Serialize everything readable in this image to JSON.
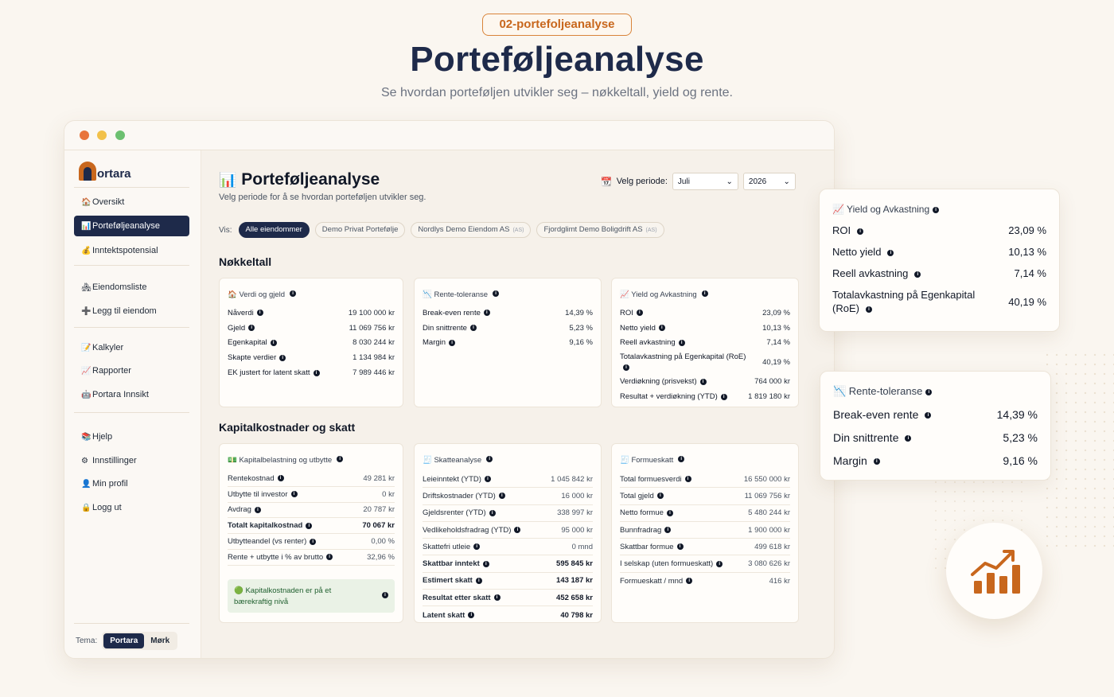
{
  "hero": {
    "tag": "02-portefoljeanalyse",
    "title": "Porteføljeanalyse",
    "subtitle": "Se hvordan porteføljen utvikler seg – nøkkeltall, yield og rente."
  },
  "colors": {
    "navy": "#1e2a4a",
    "accent": "#c8671d",
    "background": "#faf6f0"
  },
  "sidebar": {
    "logo_text": "ortara",
    "items": [
      {
        "icon": "house-icon",
        "glyph": "🏠",
        "label": "Oversikt"
      },
      {
        "icon": "bar-chart-icon",
        "glyph": "📊",
        "label": "Porteføljeanalyse",
        "active": true
      },
      {
        "icon": "money-bag-icon",
        "glyph": "💰",
        "label": "Inntektspotensial"
      },
      {
        "icon": "houses-icon",
        "glyph": "🏘",
        "label": "Eiendomsliste"
      },
      {
        "icon": "plus-icon",
        "glyph": "➕",
        "label": "Legg til eiendom"
      },
      {
        "icon": "memo-icon",
        "glyph": "📝",
        "label": "Kalkyler"
      },
      {
        "icon": "trend-up-icon",
        "glyph": "📈",
        "label": "Rapporter"
      },
      {
        "icon": "robot-icon",
        "glyph": "🤖",
        "label": "Portara Innsikt"
      },
      {
        "icon": "books-icon",
        "glyph": "📚",
        "label": "Hjelp"
      },
      {
        "icon": "gear-icon",
        "glyph": "⚙",
        "label": "Innstillinger"
      },
      {
        "icon": "user-icon",
        "glyph": "👤",
        "label": "Min profil"
      },
      {
        "icon": "lock-icon",
        "glyph": "🔒",
        "label": "Logg ut"
      }
    ],
    "theme": {
      "label": "Tema:",
      "option_1": "Portara",
      "option_2": "Mørk"
    }
  },
  "main": {
    "title": "Porteføljeanalyse",
    "title_icon": "bar-chart-icon",
    "subtitle": "Velg periode for å se hvordan porteføljen utvikler seg.",
    "period": {
      "label": "Velg periode:",
      "month": "Juli",
      "year": "2026"
    },
    "filter": {
      "label": "Vis:",
      "chips": [
        {
          "label": "Alle eiendommer",
          "tag": "",
          "active": true
        },
        {
          "label": "Demo Privat Portefølje",
          "tag": ""
        },
        {
          "label": "Nordlys Demo Eiendom AS",
          "tag": "(AS)"
        },
        {
          "label": "Fjordglimt Demo Boligdrift AS",
          "tag": "(AS)"
        }
      ]
    },
    "section_1": "Nøkkeltall",
    "section_2": "Kapitalkostnader og skatt",
    "card_verdi": {
      "title": "🏠 Verdi og gjeld",
      "rows": [
        {
          "label": "Nåverdi",
          "value": "19 100 000 kr"
        },
        {
          "label": "Gjeld",
          "value": "11 069 756 kr"
        },
        {
          "label": "Egenkapital",
          "value": "8 030 244 kr"
        },
        {
          "label": "Skapte verdier",
          "value": "1 134 984 kr"
        },
        {
          "label": "EK justert for latent skatt",
          "value": "7 989 446 kr"
        }
      ]
    },
    "card_rente": {
      "title": "📉 Rente-toleranse",
      "rows": [
        {
          "label": "Break-even rente",
          "value": "14,39 %"
        },
        {
          "label": "Din snittrente",
          "value": "5,23 %"
        },
        {
          "label": "Margin",
          "value": "9,16 %"
        }
      ]
    },
    "card_yield": {
      "title": "📈 Yield og Avkastning",
      "rows": [
        {
          "label": "ROI",
          "value": "23,09 %"
        },
        {
          "label": "Netto yield",
          "value": "10,13 %"
        },
        {
          "label": "Reell avkastning",
          "value": "7,14 %"
        },
        {
          "label": "Totalavkastning på Egenkapital (RoE)",
          "value": "40,19 %"
        },
        {
          "label": "Verdiøkning (prisvekst)",
          "value": "764 000 kr"
        },
        {
          "label": "Resultat + verdiøkning (YTD)",
          "value": "1 819 180 kr"
        }
      ]
    },
    "card_kapital": {
      "title": "💵 Kapitalbelastning og utbytte",
      "rows": [
        {
          "label": "Rentekostnad",
          "value": "49 281 kr"
        },
        {
          "label": "Utbytte til investor",
          "value": "0 kr"
        },
        {
          "label": "Avdrag",
          "value": "20 787 kr"
        },
        {
          "label": "Totalt kapitalkostnad",
          "value": "70 067 kr",
          "bold": true
        },
        {
          "label": "Utbytteandel (vs renter)",
          "value": "0,00 %"
        },
        {
          "label": "Rente + utbytte i % av brutto",
          "value": "32,96 %"
        }
      ],
      "note": "🟢 Kapitalkostnaden er på et bærekraftig nivå"
    },
    "card_skatt": {
      "title": "🧾 Skatteanalyse",
      "rows": [
        {
          "label": "Leieinntekt (YTD)",
          "value": "1 045 842 kr"
        },
        {
          "label": "Driftskostnader (YTD)",
          "value": "16 000 kr"
        },
        {
          "label": "Gjeldsrenter (YTD)",
          "value": "338 997 kr"
        },
        {
          "label": "Vedlikeholdsfradrag (YTD)",
          "value": "95 000 kr"
        },
        {
          "label": "Skattefri utleie",
          "value": "0 mnd"
        },
        {
          "label": "Skattbar inntekt",
          "value": "595 845 kr",
          "bold": true
        },
        {
          "label": "Estimert skatt",
          "value": "143 187 kr",
          "bold": true
        },
        {
          "label": "Resultat etter skatt",
          "value": "452 658 kr",
          "bold": true
        },
        {
          "label": "Latent skatt",
          "value": "40 798 kr",
          "bold": true
        }
      ]
    },
    "card_formue": {
      "title": "🧾 Formueskatt",
      "rows": [
        {
          "label": "Total formuesverdi",
          "value": "16 550 000 kr"
        },
        {
          "label": "Total gjeld",
          "value": "11 069 756 kr"
        },
        {
          "label": "Netto formue",
          "value": "5 480 244 kr"
        },
        {
          "label": "Bunnfradrag",
          "value": "1 900 000 kr"
        },
        {
          "label": "Skattbar formue",
          "value": "499 618 kr"
        },
        {
          "label": "I selskap (uten formueskatt)",
          "value": "3 080 626 kr"
        },
        {
          "label": "Formueskatt / mnd",
          "value": "416 kr"
        }
      ]
    }
  },
  "float_yield": {
    "title": "📈 Yield og Avkastning",
    "rows": [
      {
        "label": "ROI",
        "value": "23,09 %"
      },
      {
        "label": "Netto yield",
        "value": "10,13 %"
      },
      {
        "label": "Reell avkastning",
        "value": "7,14 %"
      },
      {
        "label": "Totalavkastning på Egenkapital (RoE)",
        "value": "40,19 %"
      }
    ]
  },
  "float_rente": {
    "title": "📉 Rente-toleranse",
    "rows": [
      {
        "label": "Break-even rente",
        "value": "14,39 %"
      },
      {
        "label": "Din snittrente",
        "value": "5,23 %"
      },
      {
        "label": "Margin",
        "value": "9,16 %"
      }
    ]
  }
}
